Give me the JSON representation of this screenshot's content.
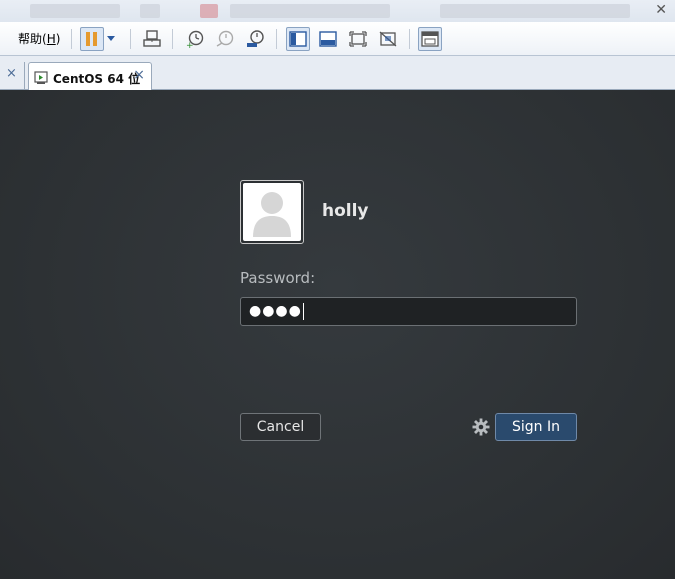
{
  "toolbar": {
    "help_menu_prefix": "帮助(",
    "help_menu_key": "H",
    "help_menu_suffix": ")",
    "icons": [
      "pause-icon",
      "dropdown-icon",
      "send-keys-icon",
      "snapshot-take-icon",
      "snapshot-revert-icon",
      "snapshot-manager-icon",
      "console-view-icon",
      "quick-switch-icon",
      "fullscreen-icon",
      "unity-icon",
      "thumbnail-view-icon"
    ]
  },
  "tabs": {
    "active_label": "CentOS 64 位",
    "close_glyph": "×"
  },
  "login": {
    "username": "holly",
    "password_label": "Password:",
    "password_value": "●●●●",
    "cancel_label": "Cancel",
    "signin_label": "Sign In"
  },
  "colors": {
    "background": "#2c3033",
    "signin_button": "#2a4a6d",
    "pause_accent": "#e59a2f"
  }
}
